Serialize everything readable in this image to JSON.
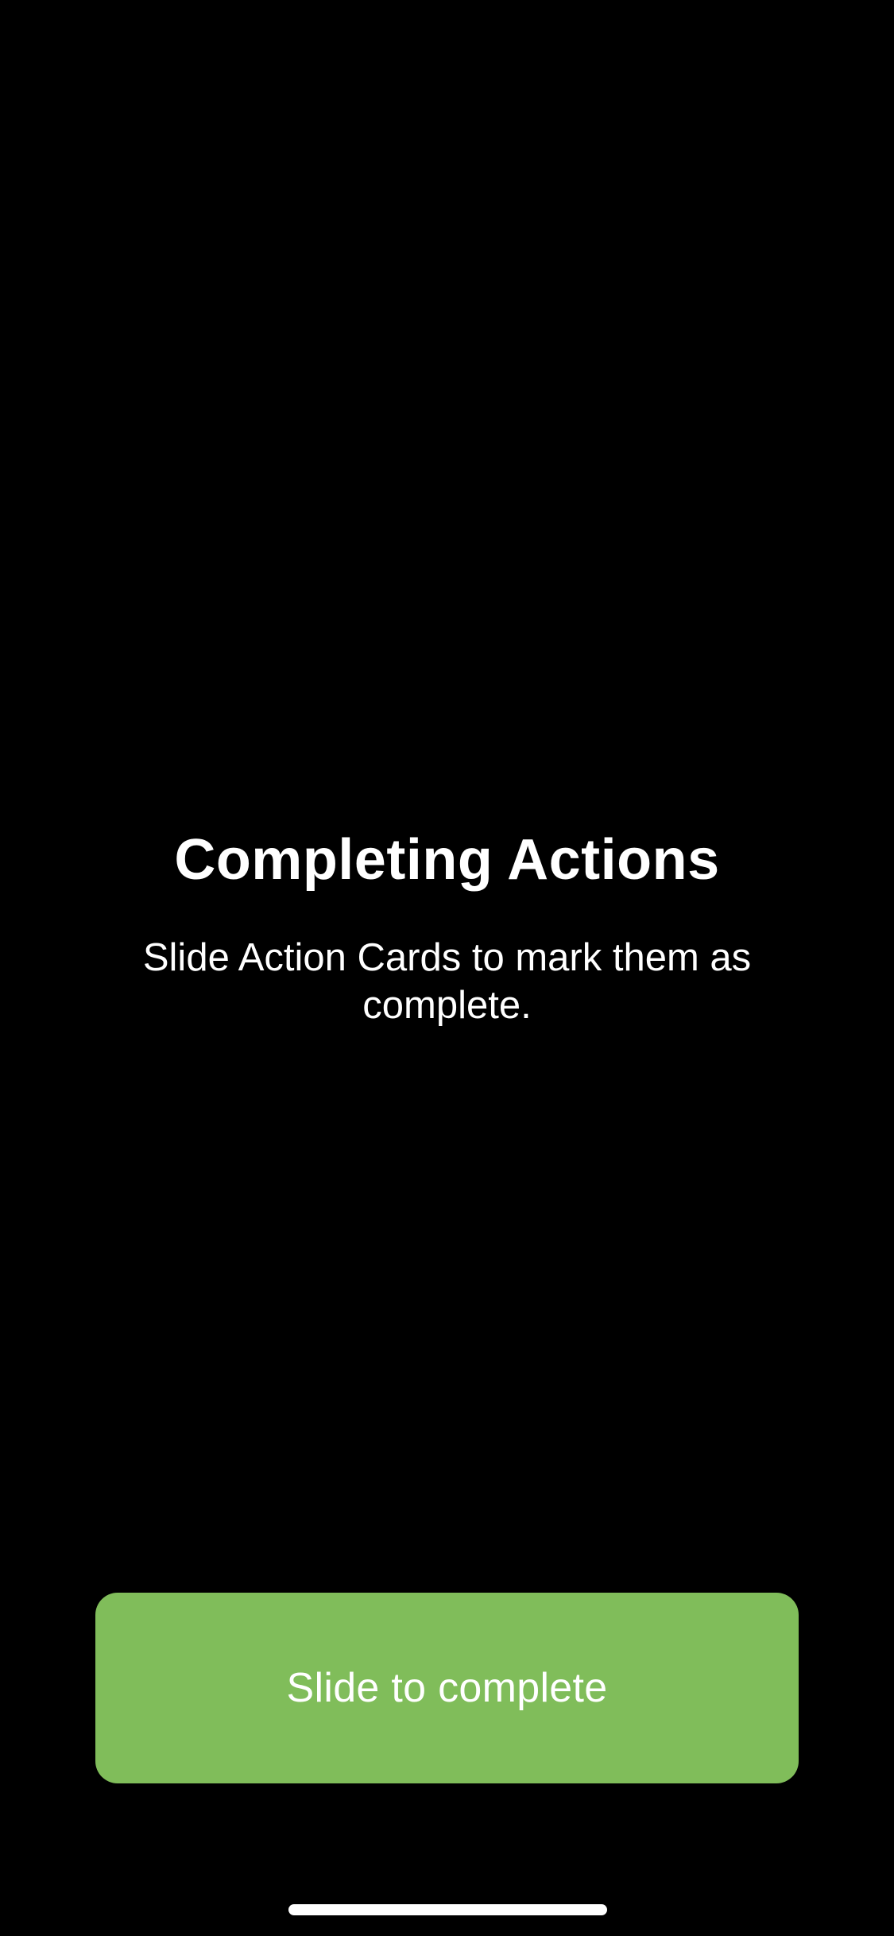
{
  "onboarding": {
    "title": "Completing Actions",
    "subtitle": "Slide Action Cards to mark them as complete."
  },
  "slide_card": {
    "label": "Slide to complete",
    "color": "#80bd5a"
  },
  "colors": {
    "background": "#000000",
    "text": "#ffffff"
  }
}
